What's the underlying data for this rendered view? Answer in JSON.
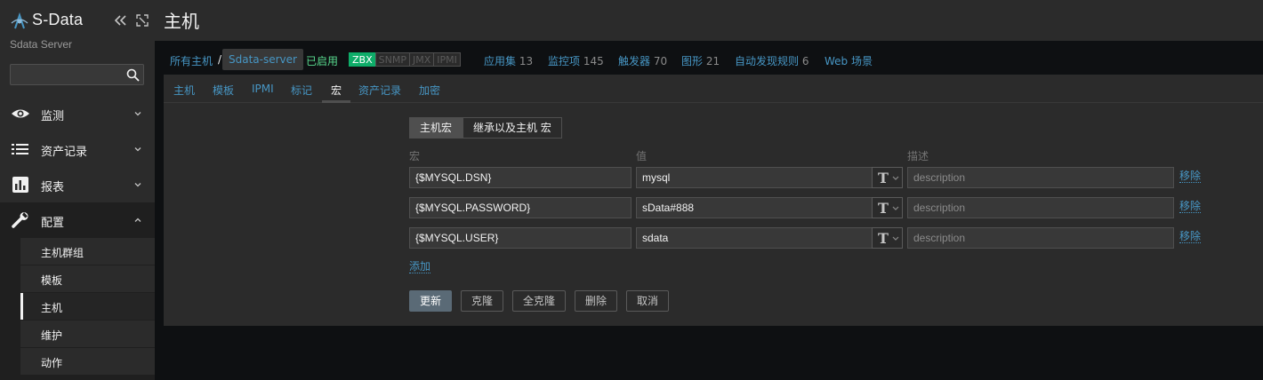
{
  "brand": {
    "name": "S-Data",
    "server_name": "Sdata Server"
  },
  "search": {
    "value": "",
    "placeholder": ""
  },
  "sidebar": {
    "menu": [
      {
        "label": "监测",
        "icon": "eye-icon"
      },
      {
        "label": "资产记录",
        "icon": "list-icon"
      },
      {
        "label": "报表",
        "icon": "bar-chart-icon"
      },
      {
        "label": "配置",
        "icon": "wrench-icon"
      }
    ],
    "submenu": [
      "主机群组",
      "模板",
      "主机",
      "维护",
      "动作"
    ]
  },
  "page": {
    "title": "主机"
  },
  "host_bar": {
    "all_hosts": "所有主机",
    "separator": "/",
    "host_name": "Sdata-server",
    "status": "已启用",
    "availability": [
      "ZBX",
      "SNMP",
      "JMX",
      "IPMI"
    ],
    "links": [
      {
        "label": "应用集",
        "count": "13"
      },
      {
        "label": "监控项",
        "count": "145"
      },
      {
        "label": "触发器",
        "count": "70"
      },
      {
        "label": "图形",
        "count": "21"
      },
      {
        "label": "自动发现规则",
        "count": "6"
      },
      {
        "label": "Web 场景",
        "count": ""
      }
    ]
  },
  "tabs": [
    "主机",
    "模板",
    "IPMI",
    "标记",
    "宏",
    "资产记录",
    "加密"
  ],
  "active_tab": "宏",
  "macro_view": {
    "options": [
      "主机宏",
      "继承以及主机 宏"
    ],
    "selected": "主机宏"
  },
  "columns": {
    "macro": "宏",
    "value": "值",
    "description": "描述"
  },
  "macros": [
    {
      "macro": "{$MYSQL.DSN}",
      "value": "mysql",
      "description_placeholder": "description",
      "remove_label": "移除"
    },
    {
      "macro": "{$MYSQL.PASSWORD}",
      "value": "sData#888",
      "description_placeholder": "description",
      "remove_label": "移除"
    },
    {
      "macro": "{$MYSQL.USER}",
      "value": "sdata",
      "description_placeholder": "description",
      "remove_label": "移除"
    }
  ],
  "add_label": "添加",
  "buttons": {
    "update": "更新",
    "clone": "克隆",
    "full_clone": "全克隆",
    "delete": "删除",
    "cancel": "取消"
  },
  "colors": {
    "link": "#4796c4",
    "enabled": "#59db8f",
    "zbx": "#0ead69",
    "primary_button": "#5a6a76"
  }
}
